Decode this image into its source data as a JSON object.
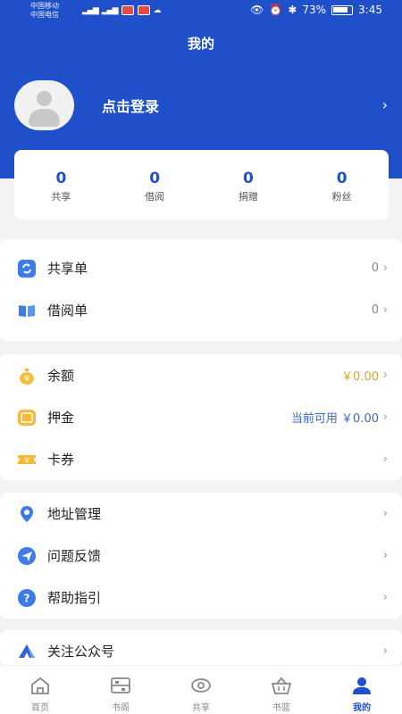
{
  "status_bar": {
    "carrier_1": "中国移动",
    "carrier_2": "中国电信",
    "battery": "73%",
    "time": "3:45"
  },
  "header": {
    "title": "我的"
  },
  "profile": {
    "login_text": "点击登录"
  },
  "stats": [
    {
      "value": "0",
      "label": "共享"
    },
    {
      "value": "0",
      "label": "借阅"
    },
    {
      "value": "0",
      "label": "捐赠"
    },
    {
      "value": "0",
      "label": "粉丝"
    }
  ],
  "orders": [
    {
      "label": "共享单",
      "value": "0"
    },
    {
      "label": "借阅单",
      "value": "0"
    }
  ],
  "wallet": [
    {
      "label": "余额",
      "value": "￥0.00"
    },
    {
      "label": "押金",
      "value": "当前可用 ￥0.00"
    },
    {
      "label": "卡券",
      "value": ""
    }
  ],
  "services": [
    {
      "label": "地址管理"
    },
    {
      "label": "问题反馈"
    },
    {
      "label": "帮助指引"
    }
  ],
  "extra": [
    {
      "label": "关注公众号"
    }
  ],
  "tabs": [
    {
      "label": "首页"
    },
    {
      "label": "书阁"
    },
    {
      "label": "共享"
    },
    {
      "label": "书篮"
    },
    {
      "label": "我的"
    }
  ],
  "colors": {
    "primary": "#1f4fc9",
    "gold": "#d8a526",
    "page_bg": "#f2f3f5"
  }
}
